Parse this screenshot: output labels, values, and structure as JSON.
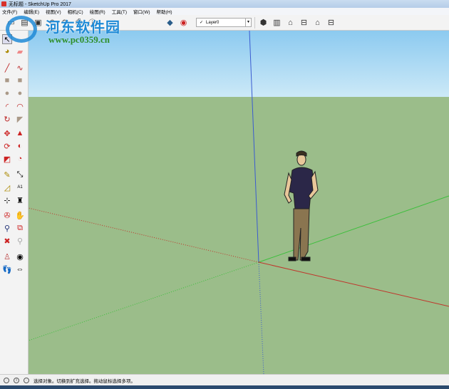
{
  "window": {
    "title": "无标题 - SketchUp Pro 2017"
  },
  "menu": [
    "文件(F)",
    "编辑(E)",
    "视图(V)",
    "相机(C)",
    "绘图(R)",
    "工具(T)",
    "窗口(W)",
    "帮助(H)"
  ],
  "layer": {
    "check": "✓",
    "value": "Layer0"
  },
  "watermark": {
    "name": "河东软件园",
    "url": "www.pc0359.cn"
  },
  "status": {
    "message": "选择对象。切换到扩充选择。拖动鼠标选择多项。"
  },
  "colors": {
    "sky": "#a8d7f2",
    "ground": "#9bbd8a",
    "red_axis": "#c0352b",
    "green_axis": "#3bbf3b",
    "blue_axis": "#3a5bd0"
  }
}
